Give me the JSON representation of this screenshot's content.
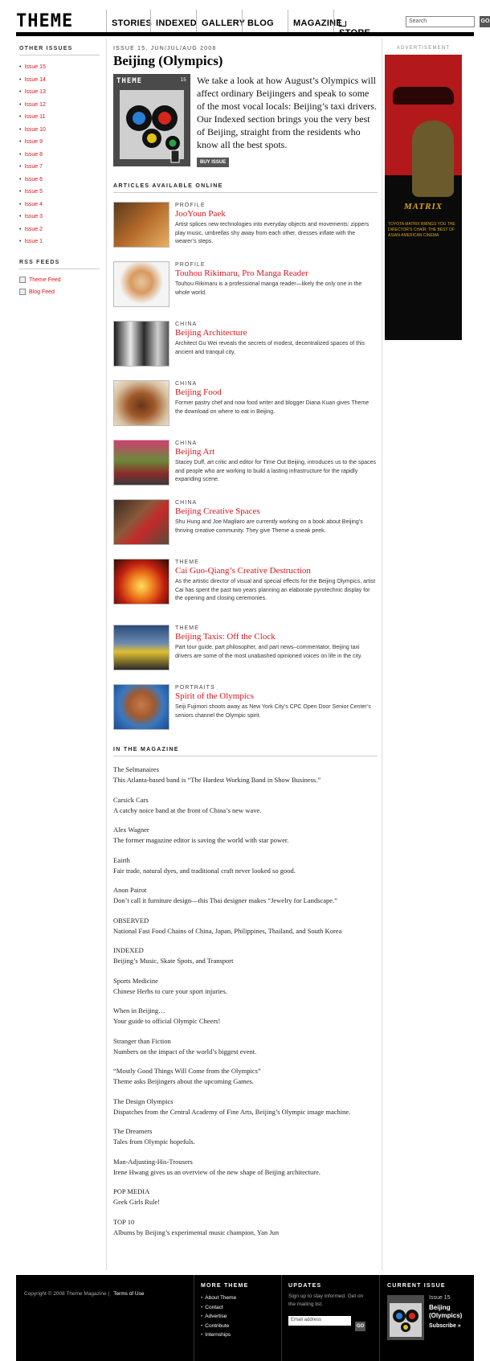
{
  "header": {
    "logo": "THEME",
    "nav": [
      "STORIES",
      "INDEXED",
      "GALLERY",
      "BLOG",
      "MAGAZINE",
      "STORE"
    ],
    "active_nav": "MAGAZINE",
    "search_placeholder": "Search",
    "search_button": "GO"
  },
  "sidebar": {
    "issues_heading": "OTHER ISSUES",
    "issues": [
      "Issue 15",
      "Issue 14",
      "Issue 13",
      "Issue 12",
      "Issue 11",
      "Issue 10",
      "Issue 9",
      "Issue 8",
      "Issue 7",
      "Issue 6",
      "Issue 5",
      "Issue 4",
      "Issue 3",
      "Issue 2",
      "Issue 1"
    ],
    "rss_heading": "RSS FEEDS",
    "feeds": [
      "Theme Feed",
      "Blog Feed"
    ]
  },
  "main": {
    "issue_kicker": "ISSUE 15, JUN/JUL/AUG 2008",
    "issue_title": "Beijing (Olympics)",
    "cover_logo": "THEME",
    "cover_num": "15",
    "intro": "We take a look at how August’s Olympics will affect ordinary Beijingers and speak to some of the most vocal locals: Beijing’s taxi drivers. Our Indexed section brings you the very best of Beijing, straight from the residents who know all the best spots.",
    "buy_button": "BUY ISSUE",
    "articles_heading": "ARTICLES AVAILABLE ONLINE",
    "articles": [
      {
        "category": "PROFILE",
        "title": "JooYoun Paek",
        "desc": "Artist splices new technologies into everyday objects and movements: zippers play music, umbrellas shy away from each other, dresses inflate with the wearer’s steps."
      },
      {
        "category": "PROFILE",
        "title": "Touhou Rikimaru, Pro Manga Reader",
        "desc": "Touhou Rikimaru is a professional manga reader—likely the only one in the whole world."
      },
      {
        "category": "CHINA",
        "title": "Beijing Architecture",
        "desc": "Architect Gu Wei reveals the secrets of modest, decentralized spaces of this ancient and tranquil city."
      },
      {
        "category": "CHINA",
        "title": "Beijing Food",
        "desc": "Former pastry chef and now food writer and blogger Diana Kuan gives Theme the download on where to eat in Beijing."
      },
      {
        "category": "CHINA",
        "title": "Beijing Art",
        "desc": "Stacey Duff, art critic and editor for Time Out Beijing, introduces us to the spaces and people who are working to build a lasting infrastructure for the rapidly expanding scene."
      },
      {
        "category": "CHINA",
        "title": "Beijing Creative Spaces",
        "desc": "Shu Hung and Joe Magliaro are currently working on a book about Beijing’s thriving creative community. They give Theme a sneak peek."
      },
      {
        "category": "THEME",
        "title": "Cai Guo-Qiang’s Creative Destruction",
        "desc": "As the artistic director of visual and special effects for the Beijing Olympics, artist Cai has spent the past two years planning an elaborate pyrotechnic display for the opening and closing ceremonies."
      },
      {
        "category": "THEME",
        "title": "Beijing Taxis: Off the Clock",
        "desc": "Part tour guide, part philosopher, and part news–commentator, Beijing taxi drivers are some of the most unabashed opinioned voices on life in the city."
      },
      {
        "category": "PORTRAITS",
        "title": "Spirit of the Olympics",
        "desc": "Seiji Fujimori shoots away as New York City’s CPC Open Door Senior Center’s seniors channel the Olympic spirit."
      }
    ],
    "magazine_heading": "IN THE MAGAZINE",
    "magazine": [
      {
        "title": "The Selmanaires",
        "desc": "This Atlanta-based band is “The Hardest Working Band in Show Business.”"
      },
      {
        "title": "Carsick Cars",
        "desc": "A catchy noice band at the front of China’s new wave."
      },
      {
        "title": "Alex Wagner",
        "desc": "The former magazine editor is saving the world with star power."
      },
      {
        "title": "Eairth",
        "desc": "Fair trade, natural dyes, and traditional craft never looked so good."
      },
      {
        "title": "Anon Pairot",
        "desc": "Don’t call it furniture design—this Thai designer makes “Jewelry for Landscape.”"
      },
      {
        "title": "OBSERVED",
        "desc": "National Fast Food Chains of China, Japan, Philippines, Thailand, and South Korea"
      },
      {
        "title": "INDEXED",
        "desc": "Beijing’s Music, Skate Spots, and Transport"
      },
      {
        "title": "Sports Medicine",
        "desc": "Chinese Herbs to cure your sport injuries."
      },
      {
        "title": "When in Beijing…",
        "desc": "Your guide to official Olympic Cheers!"
      },
      {
        "title": "Stranger than Fiction",
        "desc": "Numbers on the impact of the world’s biggest event."
      },
      {
        "title": "“Mostly Good Things Will Come from the Olympics”",
        "desc": "Theme asks Beijingers about the upcoming Games."
      },
      {
        "title": "The Design Olympics",
        "desc": "Dispatches from the Central Academy of Fine Arts, Beijing’s Olympic image machine."
      },
      {
        "title": "The Dreamers",
        "desc": "Tales from Olympic hopefuls."
      },
      {
        "title": "Man-Adjusting-His-Trousers",
        "desc": "Irene Hwang gives us an overview of the new shape of Beijing architecture."
      },
      {
        "title": "POP MEDIA",
        "desc": "Geek Girls Rule!"
      },
      {
        "title": "TOP 10",
        "desc": "Albums by Beijing’s experimental music champion, Yan Jun"
      }
    ]
  },
  "ad": {
    "label": "ADVERTISEMENT",
    "brand": "MATRIX",
    "copy": "TOYOTA MATRIX BRINGS YOU THE DIRECTOR’S CHAIR: THE BEST OF ASIAN AMERICAN CINEMA"
  },
  "footer": {
    "copyright": "Copyright © 2008 Theme Magazine |",
    "terms": "Terms of Use",
    "more_heading": "MORE THEME",
    "more_links": [
      "About Theme",
      "Contact",
      "Advertise",
      "Contribute",
      "Internships"
    ],
    "updates_heading": "UPDATES",
    "updates_text": "Sign up to stay informed. Get on the mailing list.",
    "email_placeholder": "Email address",
    "email_button": "GO",
    "current_heading": "CURRENT ISSUE",
    "current_issue": "Issue 15",
    "current_title": "Beijing (Olympics)",
    "subscribe": "Subscribe »"
  },
  "colors": {
    "accent": "#d8141c",
    "nav_active": "#e31f26",
    "footer_bg": "#000000"
  }
}
